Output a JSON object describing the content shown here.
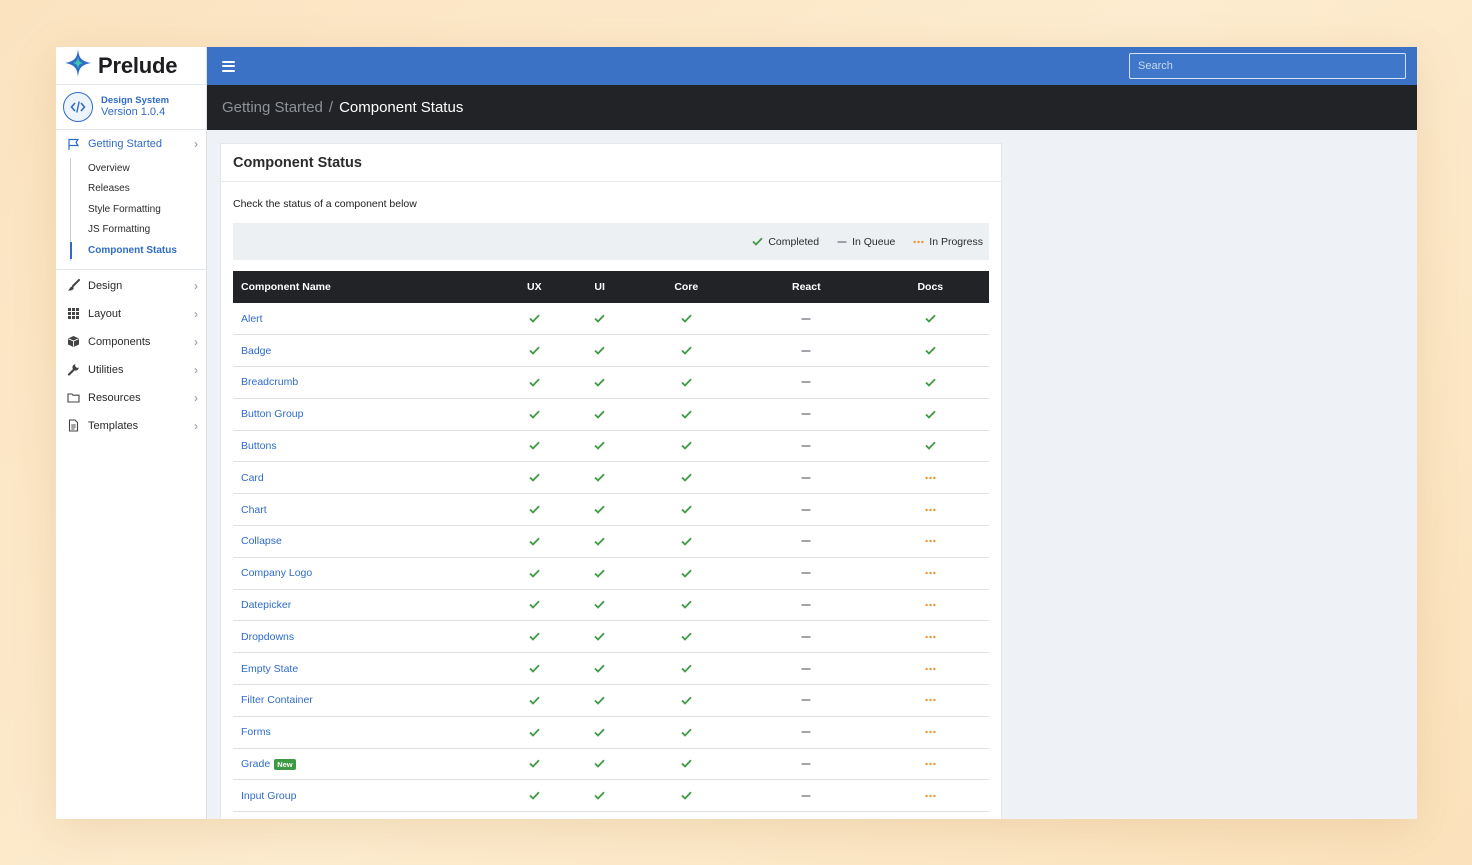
{
  "app": {
    "brand": "Prelude",
    "version_label": "Design System",
    "version_num": "Version 1.0.4"
  },
  "sidebar": {
    "getting_started": {
      "label": "Getting Started",
      "items": [
        {
          "label": "Overview",
          "active": false
        },
        {
          "label": "Releases",
          "active": false
        },
        {
          "label": "Style Formatting",
          "active": false
        },
        {
          "label": "JS Formatting",
          "active": false
        },
        {
          "label": "Component Status",
          "active": true
        }
      ]
    },
    "nav": [
      {
        "label": "Design",
        "icon": "brush-icon"
      },
      {
        "label": "Layout",
        "icon": "grid-icon"
      },
      {
        "label": "Components",
        "icon": "cube-icon"
      },
      {
        "label": "Utilities",
        "icon": "wrench-icon"
      },
      {
        "label": "Resources",
        "icon": "folder-icon"
      },
      {
        "label": "Templates",
        "icon": "document-icon"
      }
    ]
  },
  "topbar": {
    "search_placeholder": "Search"
  },
  "breadcrumb": {
    "parent": "Getting Started",
    "separator": "/",
    "current": "Component Status"
  },
  "card": {
    "title": "Component Status",
    "intro": "Check the status of a component below",
    "legend": {
      "completed": "Completed",
      "queue": "In Queue",
      "progress": "In Progress"
    }
  },
  "table": {
    "headers": [
      "Component Name",
      "UX",
      "UI",
      "Core",
      "React",
      "Docs"
    ],
    "rows": [
      {
        "name": "Alert",
        "badge": "",
        "status": [
          "done",
          "done",
          "done",
          "queue",
          "done"
        ]
      },
      {
        "name": "Badge",
        "badge": "",
        "status": [
          "done",
          "done",
          "done",
          "queue",
          "done"
        ]
      },
      {
        "name": "Breadcrumb",
        "badge": "",
        "status": [
          "done",
          "done",
          "done",
          "queue",
          "done"
        ]
      },
      {
        "name": "Button Group",
        "badge": "",
        "status": [
          "done",
          "done",
          "done",
          "queue",
          "done"
        ]
      },
      {
        "name": "Buttons",
        "badge": "",
        "status": [
          "done",
          "done",
          "done",
          "queue",
          "done"
        ]
      },
      {
        "name": "Card",
        "badge": "",
        "status": [
          "done",
          "done",
          "done",
          "queue",
          "progress"
        ]
      },
      {
        "name": "Chart",
        "badge": "",
        "status": [
          "done",
          "done",
          "done",
          "queue",
          "progress"
        ]
      },
      {
        "name": "Collapse",
        "badge": "",
        "status": [
          "done",
          "done",
          "done",
          "queue",
          "progress"
        ]
      },
      {
        "name": "Company Logo",
        "badge": "",
        "status": [
          "done",
          "done",
          "done",
          "queue",
          "progress"
        ]
      },
      {
        "name": "Datepicker",
        "badge": "",
        "status": [
          "done",
          "done",
          "done",
          "queue",
          "progress"
        ]
      },
      {
        "name": "Dropdowns",
        "badge": "",
        "status": [
          "done",
          "done",
          "done",
          "queue",
          "progress"
        ]
      },
      {
        "name": "Empty State",
        "badge": "",
        "status": [
          "done",
          "done",
          "done",
          "queue",
          "progress"
        ]
      },
      {
        "name": "Filter Container",
        "badge": "",
        "status": [
          "done",
          "done",
          "done",
          "queue",
          "progress"
        ]
      },
      {
        "name": "Forms",
        "badge": "",
        "status": [
          "done",
          "done",
          "done",
          "queue",
          "progress"
        ]
      },
      {
        "name": "Grade",
        "badge": "New",
        "status": [
          "done",
          "done",
          "done",
          "queue",
          "progress"
        ]
      },
      {
        "name": "Input Group",
        "badge": "",
        "status": [
          "done",
          "done",
          "done",
          "queue",
          "progress"
        ]
      }
    ]
  },
  "colors": {
    "primary": "#3b72c6",
    "link": "#2f6bc8",
    "done": "#3e9a45",
    "queue": "#8a8f96",
    "progress": "#f0922b",
    "dark": "#212326"
  }
}
